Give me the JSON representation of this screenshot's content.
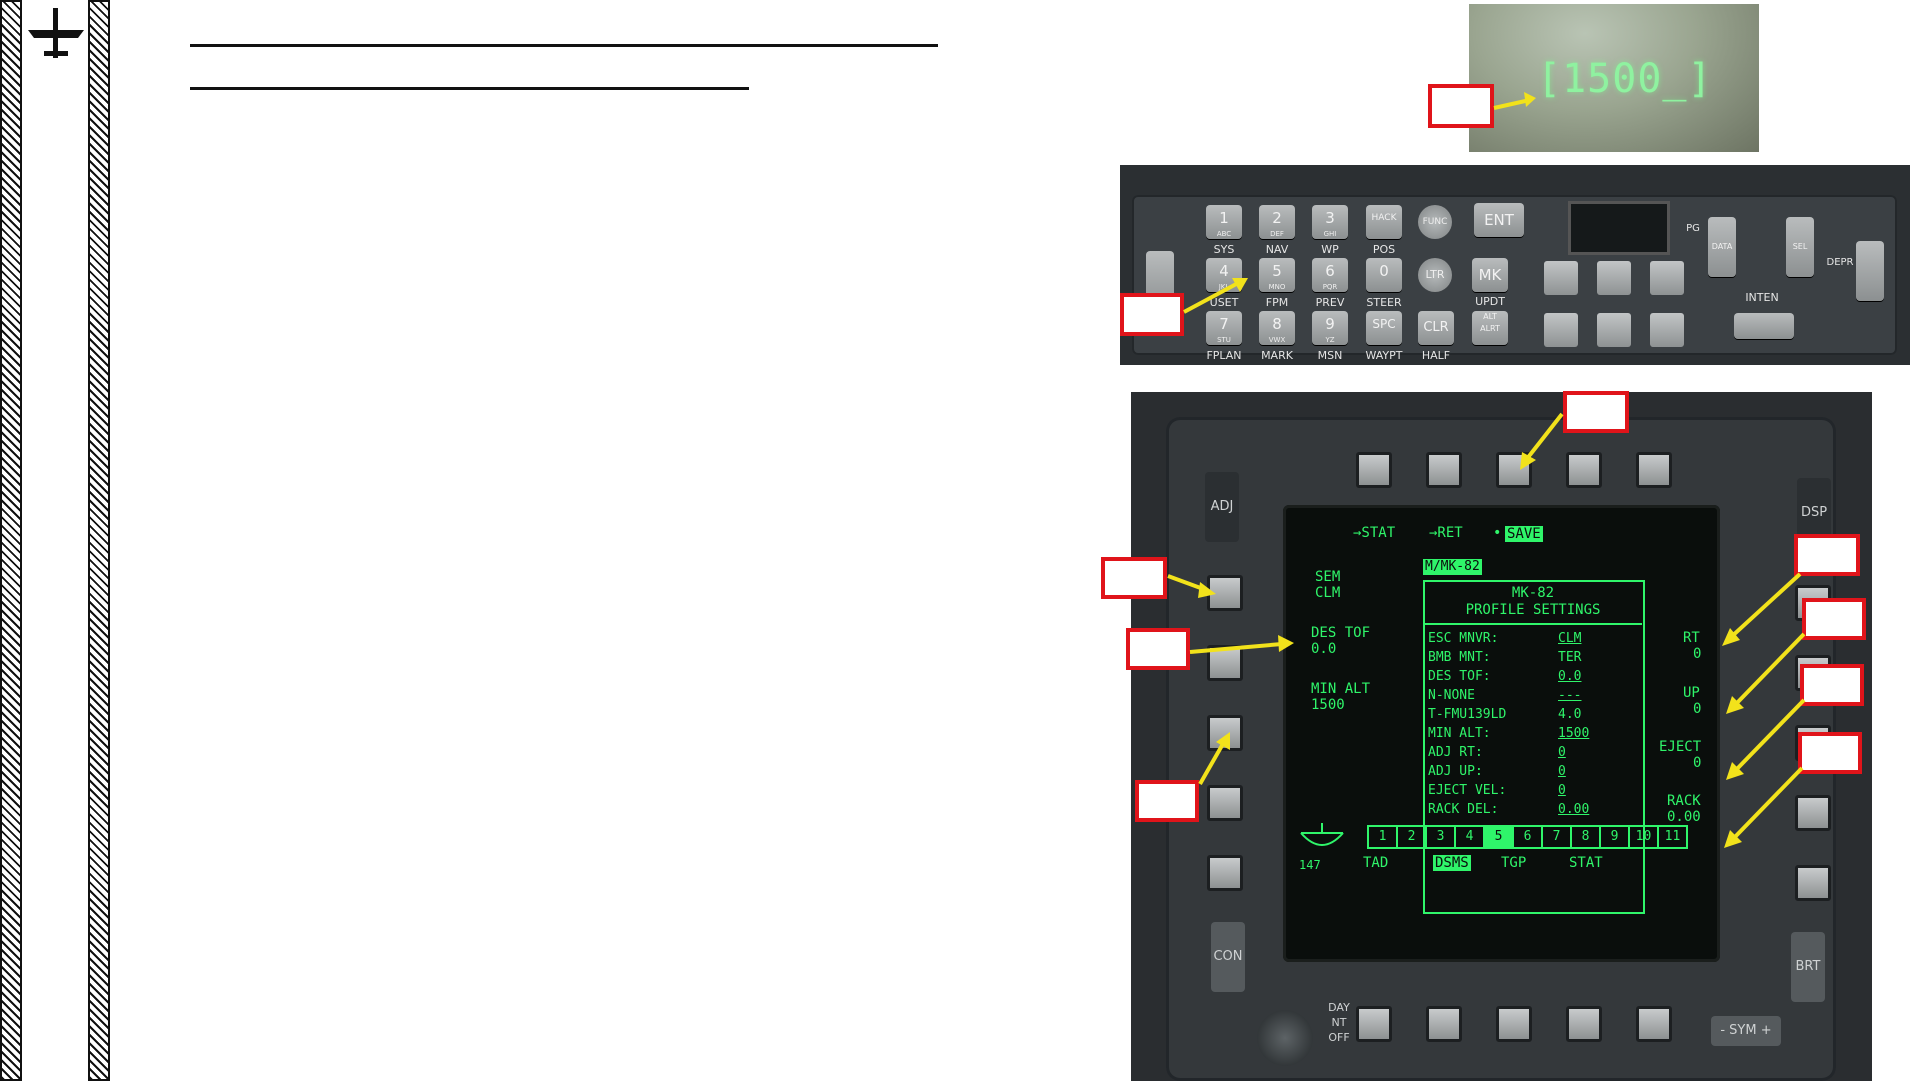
{
  "sidebar": {
    "logo_icon": "aircraft-icon"
  },
  "hud": {
    "input_value": "[1500_]"
  },
  "ufc": {
    "keys": [
      {
        "num": "1",
        "sub": "ABC",
        "label": "SYS"
      },
      {
        "num": "2",
        "sub": "DEF",
        "label": "NAV"
      },
      {
        "num": "3",
        "sub": "GHI",
        "label": "WP"
      },
      {
        "num": "HACK",
        "sub": "",
        "label": "POS"
      },
      {
        "num": "4",
        "sub": "JKL",
        "label": "USET"
      },
      {
        "num": "5",
        "sub": "MNO",
        "label": "FPM"
      },
      {
        "num": "6",
        "sub": "PQR",
        "label": "PREV"
      },
      {
        "num": "0",
        "sub": "",
        "label": "STEER"
      },
      {
        "num": "7",
        "sub": "STU",
        "label": "FPLAN"
      },
      {
        "num": "8",
        "sub": "VWX",
        "label": "MARK"
      },
      {
        "num": "9",
        "sub": "YZ",
        "label": "MSN"
      },
      {
        "num": "SPC",
        "sub": "",
        "label": "WAYPT"
      }
    ],
    "func": "FUNC",
    "ltr": "LTR",
    "ent": "ENT",
    "mk": "MK",
    "clr": "CLR",
    "alt_alrt": "ALT ALRT",
    "updt": "UPDT",
    "half": "HALF",
    "steer": "STEER",
    "data": "DATA",
    "sel": "SEL",
    "inten": "INTEN",
    "depr": "DEPR",
    "pg": "PG"
  },
  "mfcd": {
    "top_menu": {
      "stat": "→STAT",
      "ret": "→RET",
      "save": "SAVE"
    },
    "tag": "M/MK-82",
    "panel_title": "MK-82",
    "panel_subtitle": "PROFILE SETTINGS",
    "rows": [
      {
        "k": "ESC MNVR:",
        "v": "CLM"
      },
      {
        "k": "BMB MNT:",
        "v": "TER"
      },
      {
        "k": "DES TOF:",
        "v": "0.0"
      },
      {
        "k": "N-NONE",
        "v": "---"
      },
      {
        "k": "T-FMU139LD",
        "v": "4.0"
      },
      {
        "k": "MIN ALT:",
        "v": "1500"
      },
      {
        "k": " ADJ RT:",
        "v": "0"
      },
      {
        "k": " ADJ UP:",
        "v": "0"
      },
      {
        "k": " EJECT VEL:",
        "v": "0"
      },
      {
        "k": " RACK DEL:",
        "v": "0.00"
      }
    ],
    "left": {
      "sem": "SEM",
      "clm": "CLM",
      "des_tof": "DES TOF",
      "des_tof_val": "0.0",
      "min_alt": "MIN ALT",
      "min_alt_val": "1500"
    },
    "right": {
      "rt": "RT",
      "rt_val": "0",
      "up": "UP",
      "up_val": "0",
      "eject": "EJECT",
      "eject_val": "0",
      "rack": "RACK",
      "rack_val": "0.00"
    },
    "tabs": [
      "1",
      "2",
      "3",
      "4",
      "5",
      "6",
      "7",
      "8",
      "9",
      "10",
      "11"
    ],
    "bottom": {
      "heading": "147",
      "tad": "TAD",
      "dsms": "DSMS",
      "tgp": "TGP",
      "stat": "STAT"
    },
    "bezel": {
      "adj": "ADJ",
      "dsp": "DSP",
      "con": "CON",
      "brt": "BRT",
      "sym": "- SYM +",
      "day_nt_off": "DAY NT OFF"
    }
  }
}
